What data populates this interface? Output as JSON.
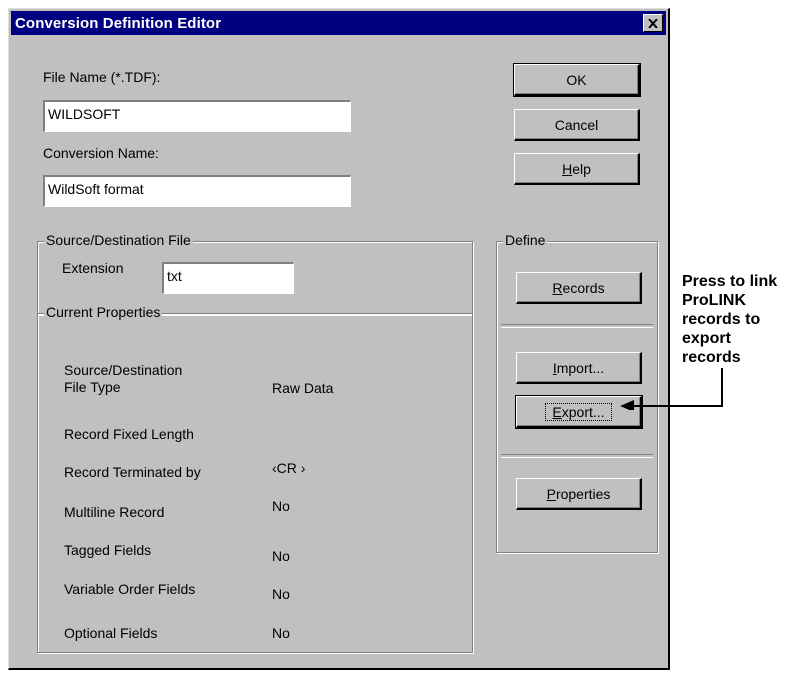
{
  "window": {
    "title": "Conversion Definition Editor",
    "close_glyph": "✕"
  },
  "fields": {
    "file_name_label": "File Name (*.TDF):",
    "file_name_value": "WILDSOFT",
    "conversion_name_label": "Conversion Name:",
    "conversion_name_value": "WildSoft format"
  },
  "buttons": {
    "ok": "OK",
    "cancel": "Cancel",
    "help": "Help"
  },
  "source_group": {
    "title": "Source/Destination File",
    "extension_label": "Extension",
    "extension_value": "txt"
  },
  "properties_group": {
    "title": "Current Properties",
    "rows": [
      {
        "label_line1": "Source/Destination",
        "label_line2": "File Type",
        "value": "Raw Data"
      },
      {
        "label": "Record Fixed Length",
        "value": ""
      },
      {
        "label": "Record Terminated by",
        "value": "‹CR ›"
      },
      {
        "label": "Multiline Record",
        "value": "No"
      },
      {
        "label": "Tagged Fields",
        "value": "No"
      },
      {
        "label": "Variable Order Fields",
        "value": "No"
      },
      {
        "label": "Optional Fields",
        "value": "No"
      }
    ]
  },
  "define_group": {
    "title": "Define",
    "records": "Records",
    "import": "Import...",
    "export": "Export...",
    "properties": "Properties"
  },
  "annotation": {
    "lines": [
      "Press to link",
      "ProLINK",
      "records to",
      "export",
      "records"
    ]
  },
  "colors": {
    "face": "#c0c0c0",
    "title_bar": "#000080"
  },
  "icons": {
    "close": "close-icon",
    "arrow": "arrow-left-icon"
  }
}
